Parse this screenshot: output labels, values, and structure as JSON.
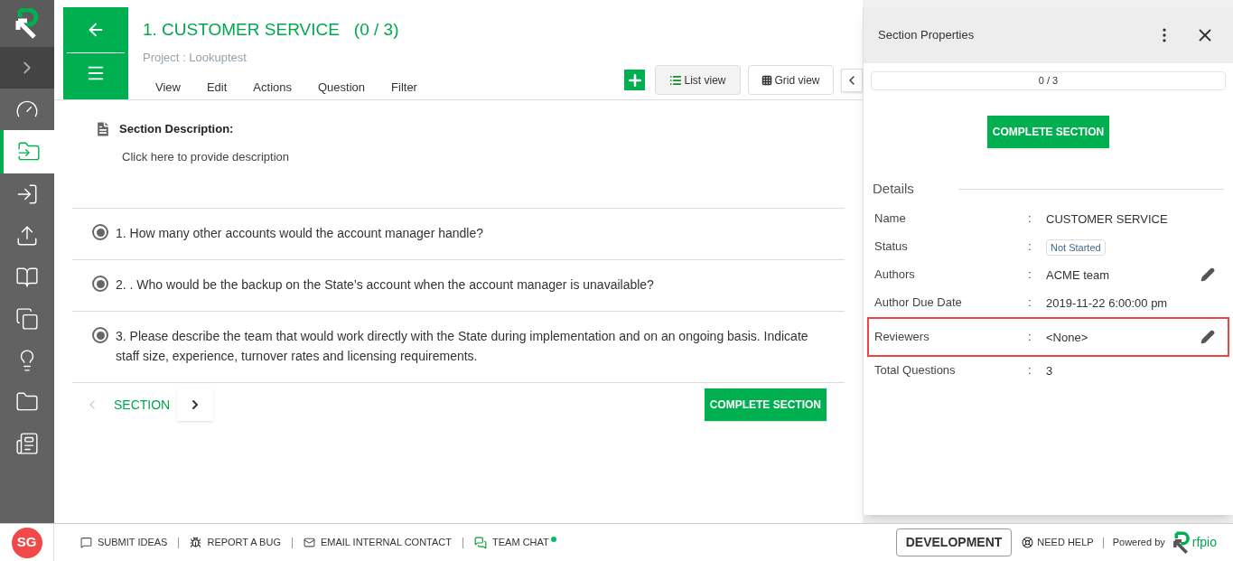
{
  "sidebar": {
    "items": [
      {
        "selected": false
      },
      {
        "selected": true
      },
      {
        "selected": false
      },
      {
        "selected": false
      },
      {
        "selected": false
      },
      {
        "selected": false
      },
      {
        "selected": false
      },
      {
        "selected": false
      },
      {
        "selected": false
      }
    ],
    "avatar": "SG"
  },
  "header": {
    "title": "1. CUSTOMER SERVICE",
    "count": "(0 / 3)",
    "project": "Project : Lookuptest",
    "menu": [
      "View",
      "Edit",
      "Actions",
      "Question",
      "Filter"
    ],
    "views": [
      {
        "label": "List view",
        "kind": "list",
        "selected": true
      },
      {
        "label": "Grid view",
        "kind": "grid",
        "selected": false
      }
    ]
  },
  "description": {
    "label": "Section Description:",
    "placeholder": "Click here to provide description"
  },
  "questions": [
    {
      "text": "1. How many other accounts would the account manager handle?",
      "selected": true
    },
    {
      "text": "2. . Who would be the backup on the State’s account when the account manager is unavailable?",
      "selected": true
    },
    {
      "text": "3. Please describe the team that would work directly with the State during implementation and on an ongoing basis. Indicate staff size, experience, turnover rates and licensing requirements.",
      "selected": true
    }
  ],
  "pager": {
    "label": "SECTION",
    "previous_disabled": true
  },
  "complete_button": "COMPLETE SECTION",
  "panel": {
    "title": "Section Properties",
    "progress": {
      "text": "0 / 3",
      "level": 0
    },
    "complete_button": "COMPLETE SECTION",
    "details_heading": "Details",
    "rows": [
      {
        "label": "Name",
        "separator": ":",
        "value": "CUSTOMER SERVICE",
        "kind": "text",
        "editable": false,
        "highlighted": false
      },
      {
        "label": "Status",
        "separator": ":",
        "value": "Not Started",
        "kind": "status",
        "editable": false,
        "highlighted": false
      },
      {
        "label": "Authors",
        "separator": ":",
        "value": "ACME team",
        "kind": "text",
        "editable": true,
        "highlighted": false
      },
      {
        "label": "Author Due Date",
        "separator": ":",
        "value": "2019-11-22 6:00:00 pm",
        "kind": "text",
        "editable": false,
        "highlighted": false
      },
      {
        "label": "Reviewers",
        "separator": ":",
        "value": "<None>",
        "kind": "text",
        "editable": true,
        "highlighted": true
      },
      {
        "label": "Total Questions",
        "separator": ":",
        "value": "3",
        "kind": "text",
        "editable": false,
        "highlighted": false
      }
    ]
  },
  "footer": {
    "links": [
      {
        "label": "SUBMIT IDEAS",
        "kind": "ideas"
      },
      {
        "label": "REPORT A BUG",
        "kind": "bug"
      },
      {
        "label": "EMAIL INTERNAL CONTACT",
        "kind": "mail"
      },
      {
        "label": "TEAM CHAT",
        "kind": "chat",
        "online": true
      }
    ],
    "environment": "DEVELOPMENT",
    "help": "NEED HELP",
    "powered_by": "Powered by",
    "brand": "rfpio"
  }
}
